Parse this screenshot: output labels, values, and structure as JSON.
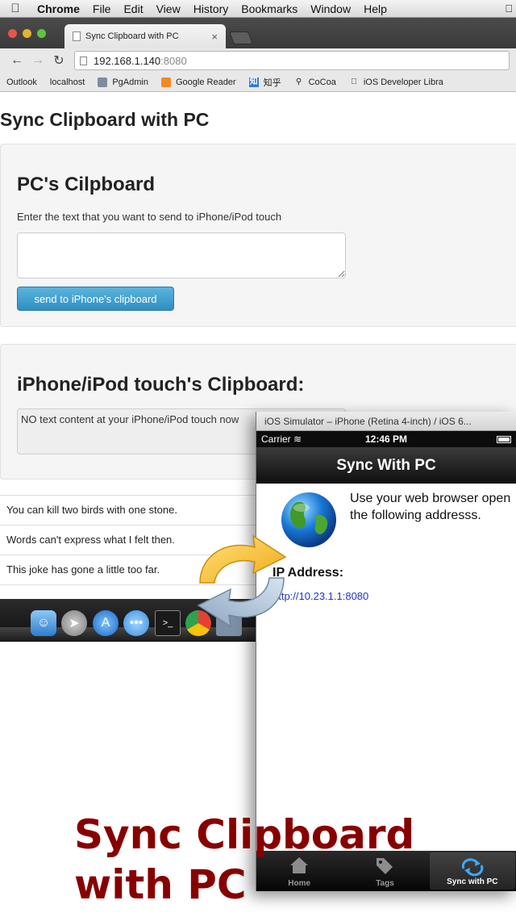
{
  "menubar": {
    "app": "Chrome",
    "items": [
      "File",
      "Edit",
      "View",
      "History",
      "Bookmarks",
      "Window",
      "Help"
    ]
  },
  "browser": {
    "tab_title": "Sync Clipboard with PC",
    "tab_close": "×",
    "url_host": "192.168.1.140",
    "url_port": ":8080",
    "bookmarks": [
      {
        "label": "Outlook",
        "icon": "page-icon"
      },
      {
        "label": "localhost",
        "icon": "page-icon"
      },
      {
        "label": "PgAdmin",
        "icon": "folder-icon"
      },
      {
        "label": "Google Reader",
        "icon": "rss-icon"
      },
      {
        "label": "知乎",
        "icon": "zhihu-icon"
      },
      {
        "label": "CoCoa",
        "icon": "cocoa-icon"
      },
      {
        "label": "iOS Developer Libra",
        "icon": "apple-icon"
      }
    ]
  },
  "webpage": {
    "title": "Sync Clipboard with PC",
    "pc_section": {
      "heading": "PC's Cilpboard",
      "hint": "Enter the text that you want to send to iPhone/iPod touch",
      "textarea_value": "",
      "button": "send to iPhone's clipboard"
    },
    "iphone_section": {
      "heading": "iPhone/iPod touch's Clipboard:",
      "content": "NO text content at your iPhone/iPod touch now"
    },
    "phrases": [
      "You can kill two birds with one stone.",
      "Words can't express what I felt then.",
      "This joke has gone a little too far."
    ]
  },
  "simulator": {
    "window_title": "iOS Simulator – iPhone (Retina 4-inch) / iOS 6...",
    "carrier": "Carrier",
    "time": "12:46 PM",
    "nav_title": "Sync With PC",
    "instructions": "Use your web browser open the following addresss.",
    "ip_label": "IP Address:",
    "ip_url": "http://10.23.1.1:8080",
    "tabs": [
      {
        "label": "Home",
        "icon": "home-icon",
        "active": false
      },
      {
        "label": "Tags",
        "icon": "tag-icon",
        "active": false
      },
      {
        "label": "Sync with PC",
        "icon": "sync-icon",
        "active": true
      }
    ]
  },
  "caption": {
    "line1": "Sync Clipboard",
    "line2": "with PC"
  },
  "colors": {
    "button_blue": "#2f8fc2",
    "caption_red": "#870000",
    "link_blue": "#2233cc"
  }
}
